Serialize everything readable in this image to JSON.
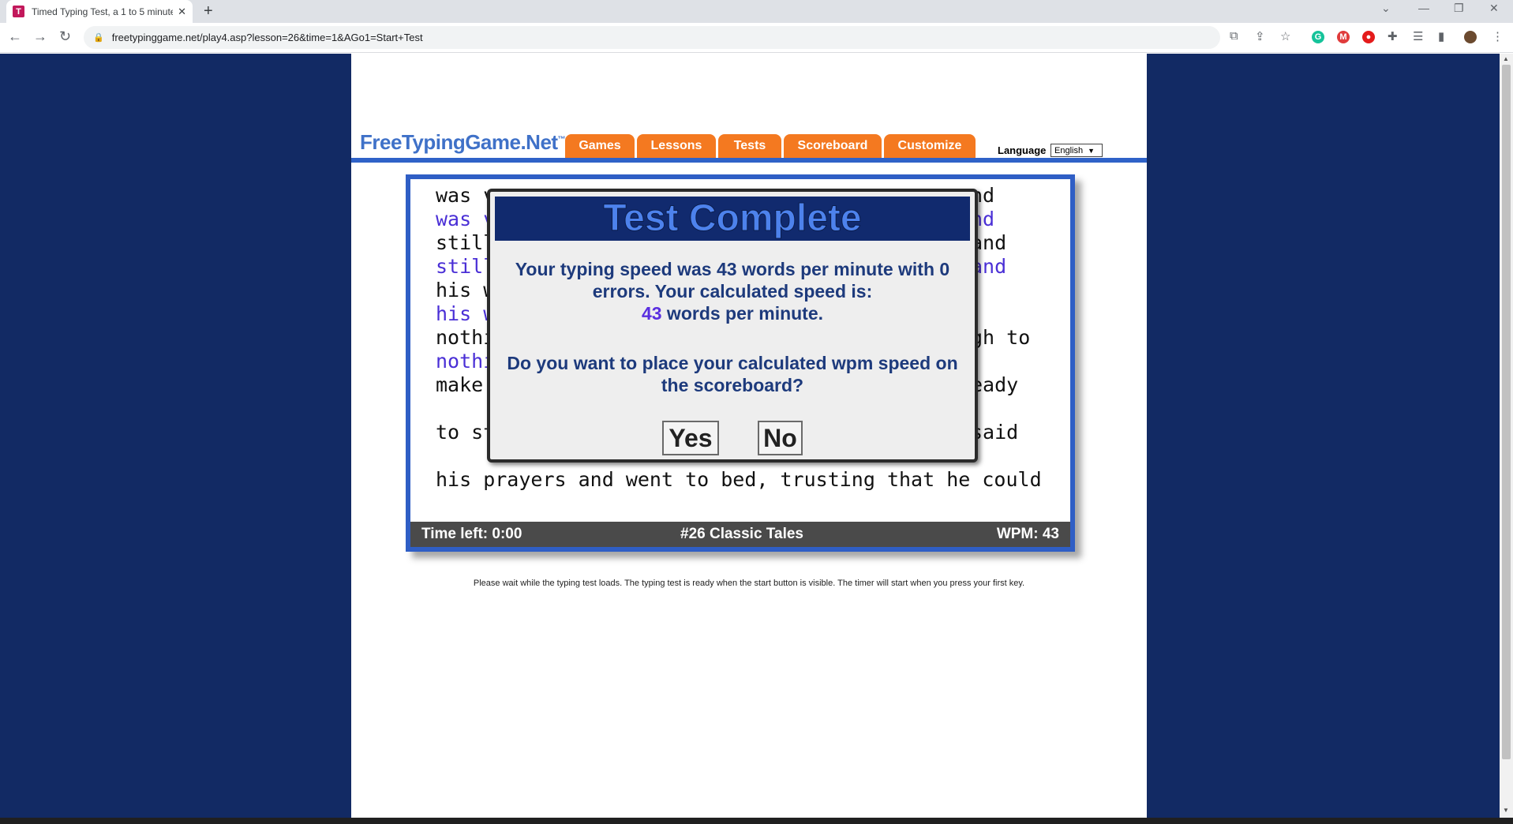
{
  "browser": {
    "tab_title": "Timed Typing Test, a 1 to 5 minute",
    "favicon_letter": "T",
    "url": "freetypinggame.net/play4.asp?lesson=26&time=1&AGo1=Start+Test"
  },
  "site": {
    "logo_text": "FreeTypingGame.Net",
    "logo_tm": "™",
    "nav": [
      "Games",
      "Lessons",
      "Tests",
      "Scoreboard",
      "Customize"
    ],
    "language_label": "Language",
    "language_value": "English"
  },
  "typing_lines": [
    {
      "text": "was v",
      "right": "nd",
      "typed": false
    },
    {
      "text": "was v",
      "right": "nd",
      "typed": true
    },
    {
      "text": "still",
      "right": "and",
      "typed": false
    },
    {
      "text": "still",
      "right": "and",
      "typed": true
    },
    {
      "text": "his w",
      "right": "",
      "typed": false
    },
    {
      "text": "his w",
      "right": "",
      "typed": true
    },
    {
      "text": "nothi",
      "right": "gh to",
      "typed": false
    },
    {
      "text": "nothi",
      "right": "",
      "typed": true
    },
    {
      "text": "make ",
      "right": "eady",
      "typed": false
    },
    {
      "text": "to st",
      "right": "said",
      "typed": false
    },
    {
      "text": "his prayers and went to bed, trusting that he could",
      "right": "",
      "typed": false
    }
  ],
  "status": {
    "time_left": "Time left: 0:00",
    "lesson": "#26 Classic Tales",
    "wpm": "WPM: 43"
  },
  "modal": {
    "title": "Test Complete",
    "line1": "Your typing speed was 43 words per minute with 0",
    "line2": "errors. Your calculated speed is:",
    "speed_value": "43",
    "speed_suffix": " words per minute.",
    "question_line1": "Do you want to place your calculated wpm speed on",
    "question_line2": "the scoreboard?",
    "yes_label": "Yes",
    "no_label": "No"
  },
  "loading_note": "Please wait while the typing test loads. The typing test is ready when the start button is visible. The timer will start when you press your first key."
}
